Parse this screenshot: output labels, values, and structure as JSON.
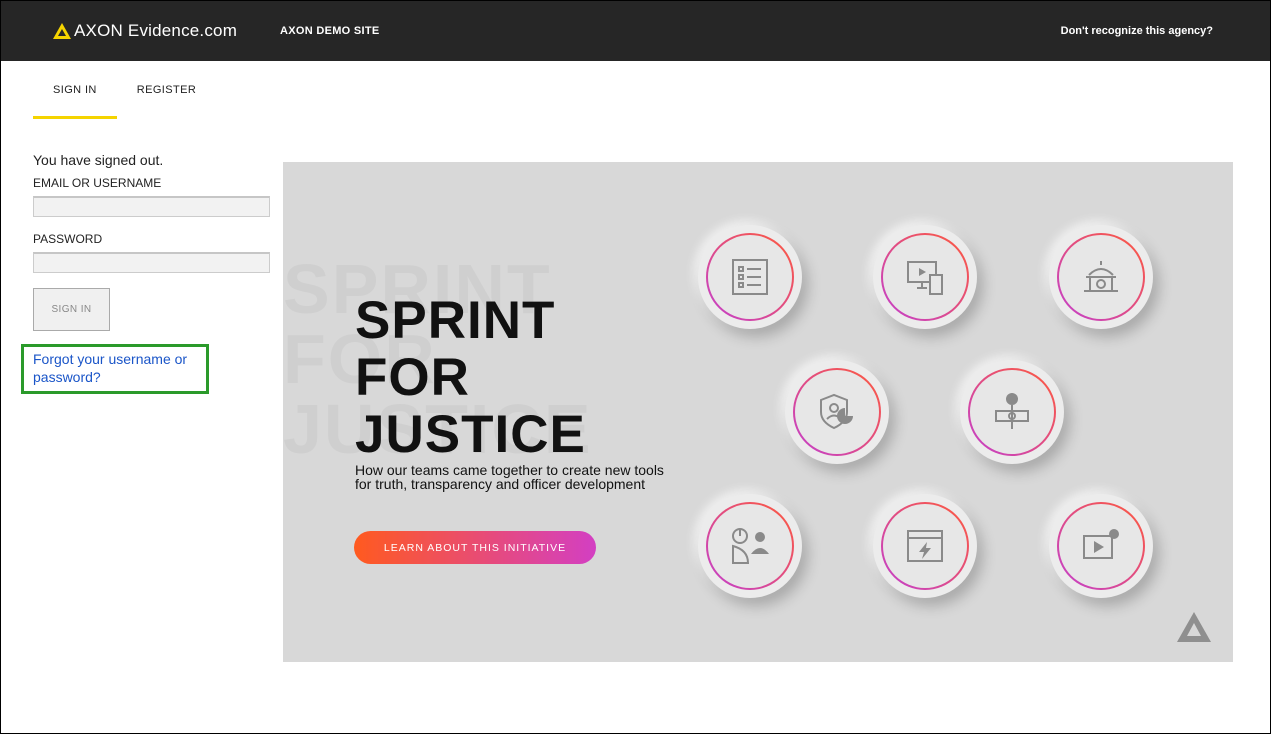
{
  "header": {
    "logo_text": "AXON Evidence.com",
    "site_name": "AXON DEMO SITE",
    "agency_link": "Don't recognize this agency?"
  },
  "tabs": [
    {
      "label": "SIGN IN",
      "active": true
    },
    {
      "label": "REGISTER",
      "active": false
    }
  ],
  "form": {
    "status": "You have signed out.",
    "email_label": "EMAIL OR USERNAME",
    "email_value": "",
    "password_label": "PASSWORD",
    "password_value": "",
    "signin_button": "SIGN IN",
    "forgot_link": "Forgot your username or password?"
  },
  "banner": {
    "headline_line1": "SPRINT",
    "headline_line2": "FOR",
    "headline_line3": "JUSTICE",
    "subtext": "How our teams came together to create new tools for truth, transparency and officer development",
    "cta": "LEARN ABOUT THIS INITIATIVE",
    "icons": [
      "document-list-icon",
      "monitor-devices-icon",
      "government-building-icon",
      "shield-chart-icon",
      "timeline-lightning-icon",
      "people-chart-icon",
      "browser-lightning-icon",
      "video-upload-icon",
      "axon-logo-icon"
    ]
  },
  "colors": {
    "accent_yellow": "#f5d400",
    "link_blue": "#1a55c8",
    "highlight_green": "#2a9a2a",
    "cta_start": "#ff5a1f",
    "cta_end": "#d33fc3"
  }
}
